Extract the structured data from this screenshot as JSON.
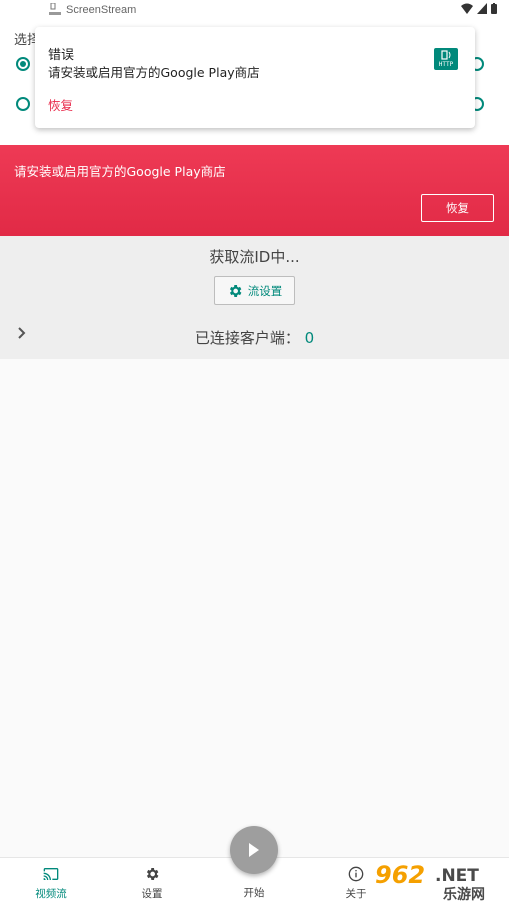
{
  "status_bar": {
    "app_title": "ScreenStream"
  },
  "underlying": {
    "section_label": "选择"
  },
  "notification": {
    "title": "错误",
    "text": "请安装或启用官方的Google Play商店",
    "action_label": "恢复",
    "app_icon_text": "HTTP"
  },
  "error_banner": {
    "message": "请安装或启用官方的Google Play商店",
    "button_label": "恢复"
  },
  "stream_info": {
    "status": "获取流ID中...",
    "settings_button": "流设置",
    "clients_label": "已连接客户端：",
    "clients_count": "0"
  },
  "bottom_nav": {
    "items": [
      {
        "label": "视频流",
        "icon": "cast-icon",
        "active": true
      },
      {
        "label": "设置",
        "icon": "gear-icon",
        "active": false
      },
      {
        "label": "关于",
        "icon": "info-icon",
        "active": false
      }
    ],
    "fab_label": "开始"
  },
  "watermark": {
    "text_top": "962.NET",
    "text_bottom": "乐游网"
  },
  "colors": {
    "accent": "#01897b",
    "error": "#e8294a",
    "fab": "#9e9e9e"
  }
}
